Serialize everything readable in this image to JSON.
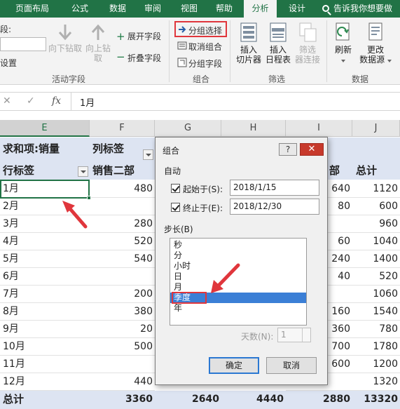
{
  "ribbon_tabs": [
    {
      "label": "页面布局",
      "active": false
    },
    {
      "label": "公式",
      "active": false
    },
    {
      "label": "数据",
      "active": false
    },
    {
      "label": "审阅",
      "active": false
    },
    {
      "label": "视图",
      "active": false
    },
    {
      "label": "帮助",
      "active": false
    },
    {
      "label": "分析",
      "active": true
    },
    {
      "label": "设计",
      "active": false
    }
  ],
  "tell_me": "告诉我你想要做",
  "ribbon": {
    "field_label_partial": "段:",
    "field_settings_partial": "设置",
    "drill_down": "向下钻取",
    "drill_up_line1": "向上钻",
    "drill_up_line2": "取",
    "expand_field": "展开字段",
    "collapse_field": "折叠字段",
    "group_active_field": "活动字段",
    "group_selection": "分组选择",
    "ungroup": "取消组合",
    "group_field": "分组字段",
    "group_group": "组合",
    "insert_slicer_line1": "插入",
    "insert_slicer_line2": "切片器",
    "insert_timeline_line1": "插入",
    "insert_timeline_line2": "日程表",
    "filter_connections_line1": "筛选",
    "filter_connections_line2": "器连接",
    "group_filter": "筛选",
    "refresh": "刷新",
    "change_source_line1": "更改",
    "change_source_line2": "数据源",
    "group_data": "数据"
  },
  "formula_bar": {
    "cancel_glyph": "✕",
    "enter_glyph": "✓",
    "fx": "fx",
    "value": "1月"
  },
  "columns": [
    "E",
    "F",
    "G",
    "H",
    "I",
    "J"
  ],
  "selected_column": "E",
  "pivot": {
    "sum_label": "求和项:销量",
    "col_labels": "列标签",
    "row_labels": "行标签",
    "col_dept2": "销售二部",
    "col_partial": "部",
    "col_total": "总计",
    "rows": [
      {
        "month": "1月",
        "f": "480",
        "i": "640",
        "j": "1120"
      },
      {
        "month": "2月",
        "f": "",
        "i": "80",
        "j": "600"
      },
      {
        "month": "3月",
        "f": "280",
        "i": "",
        "j": "960"
      },
      {
        "month": "4月",
        "f": "520",
        "i": "60",
        "j": "1040"
      },
      {
        "month": "5月",
        "f": "540",
        "i": "240",
        "j": "1400"
      },
      {
        "month": "6月",
        "f": "",
        "i": "40",
        "j": "520"
      },
      {
        "month": "7月",
        "f": "200",
        "i": "",
        "j": "1060"
      },
      {
        "month": "8月",
        "f": "380",
        "i": "160",
        "j": "1540"
      },
      {
        "month": "9月",
        "f": "20",
        "i": "360",
        "j": "780"
      },
      {
        "month": "10月",
        "f": "500",
        "i": "700",
        "j": "1780"
      },
      {
        "month": "11月",
        "f": "",
        "i": "600",
        "j": "1200"
      },
      {
        "month": "12月",
        "f": "440",
        "i": "",
        "j": "1320"
      }
    ],
    "total": {
      "label": "总计",
      "f": "3360",
      "g": "2640",
      "h": "4440",
      "i": "2880",
      "j": "13320"
    }
  },
  "dialog": {
    "title": "组合",
    "help": "?",
    "close": "✕",
    "auto_section": "自动",
    "start_label": "起始于(S):",
    "start_checked": true,
    "start_value": "2018/1/15",
    "end_label": "终止于(E):",
    "end_checked": true,
    "end_value": "2018/12/30",
    "step_section": "步长(B)",
    "step_items": [
      "秒",
      "分",
      "小时",
      "日",
      "月",
      "季度",
      "年"
    ],
    "selected_step": "季度",
    "days_label": "天数(N):",
    "days_value": "1",
    "ok": "确定",
    "cancel": "取消"
  },
  "colors": {
    "ribbon_green": "#217346",
    "highlight_red": "#e0363c",
    "pivot_band": "#dde4f2",
    "list_selection": "#3b7fd6"
  }
}
